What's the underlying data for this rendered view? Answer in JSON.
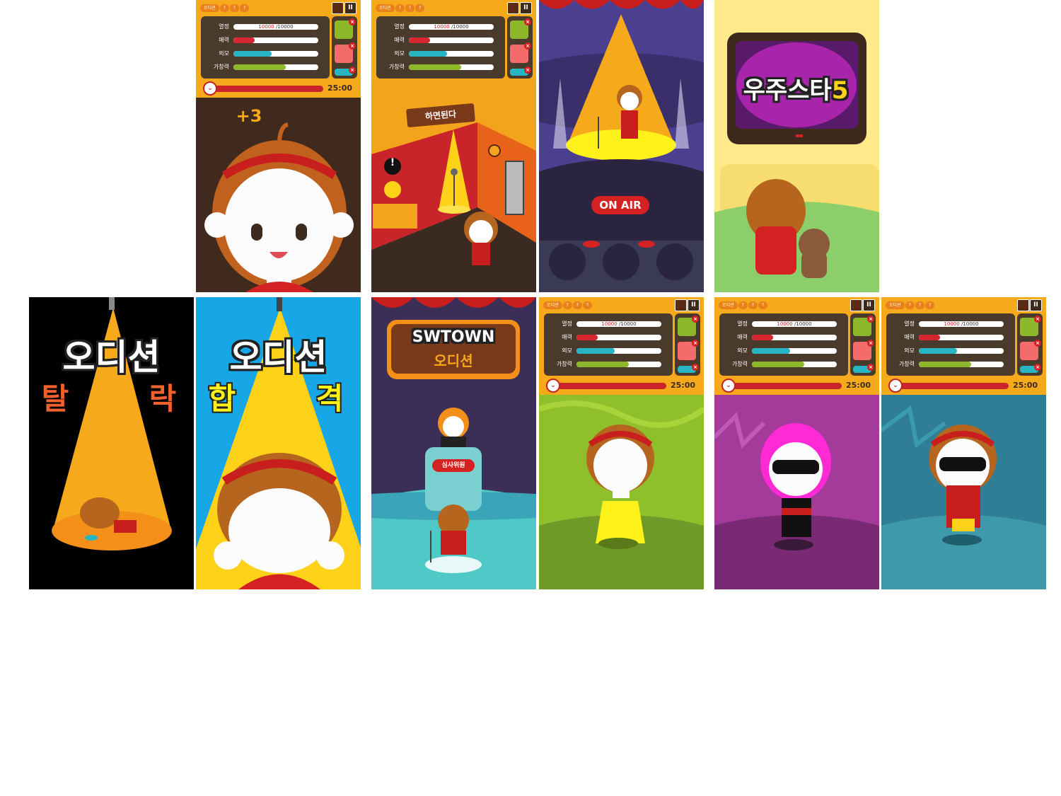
{
  "hud": {
    "tabs": [
      "오디션",
      "?",
      "?",
      "?"
    ],
    "stats": [
      {
        "label": "열정",
        "current": "10000",
        "max": "/10000",
        "level": 1.0,
        "color": "#ffffff"
      },
      {
        "label": "매력",
        "level": 0.25,
        "color": "#d7262f"
      },
      {
        "label": "외모",
        "level": 0.45,
        "color": "#27b5c4"
      },
      {
        "label": "가창력",
        "level": 0.62,
        "color": "#8db82a"
      }
    ],
    "timer": "25:00",
    "pause_symbol": "II"
  },
  "face_scene": {
    "score_popup": "+3"
  },
  "room_scene": {
    "sign": "하면된다",
    "alert": "!"
  },
  "stage_scene": {
    "on_air": "ON AIR"
  },
  "tv_scene": {
    "show_title": "우주스타",
    "show_number": "5"
  },
  "fail_scene": {
    "title": "오디션",
    "left_char": "탈",
    "right_char": "락"
  },
  "pass_scene": {
    "title": "오디션",
    "left_char": "합",
    "right_char": "격"
  },
  "swtown_scene": {
    "sign_line1": "SWTOWN",
    "sign_line2": "오디션",
    "judge_label": "심사위원"
  },
  "colors": {
    "hud_orange": "#f6a91b",
    "hud_brown": "#4a3a2c",
    "accent_red": "#c8242a",
    "spotlight_yellow": "#ffd21a"
  }
}
